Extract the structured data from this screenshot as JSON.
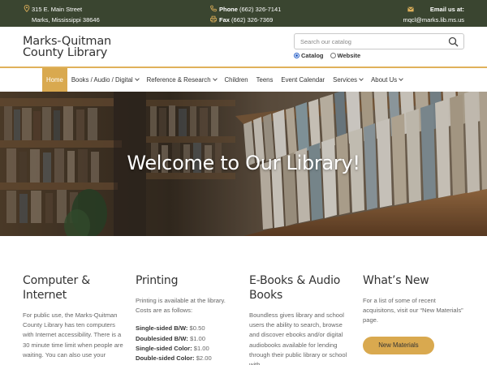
{
  "topbar": {
    "address_line1": "315 E. Main Street",
    "address_line2": "Marks, Mississippi 38646",
    "phone_label": "Phone",
    "phone_value": "(662) 326-7141",
    "fax_label": "Fax",
    "fax_value": "(662) 326-7369",
    "email_label": "Email us at:",
    "email_value": "mqcl@marks.lib.ms.us",
    "background_color": "#3a4530"
  },
  "header": {
    "title_line1": "Marks-Quitman",
    "title_line2": "County Library",
    "search_placeholder": "Search our catalog",
    "radio_catalog": "Catalog",
    "radio_website": "Website",
    "radio_selected": "Catalog"
  },
  "nav": {
    "accent_color": "#d9a94f",
    "items": [
      {
        "label": "Home",
        "active": true,
        "dropdown": false
      },
      {
        "label": "Books / Audio / Digital",
        "active": false,
        "dropdown": true
      },
      {
        "label": "Reference & Research",
        "active": false,
        "dropdown": true
      },
      {
        "label": "Children",
        "active": false,
        "dropdown": false
      },
      {
        "label": "Teens",
        "active": false,
        "dropdown": false
      },
      {
        "label": "Event Calendar",
        "active": false,
        "dropdown": false
      },
      {
        "label": "Services",
        "active": false,
        "dropdown": true
      },
      {
        "label": "About Us",
        "active": false,
        "dropdown": true
      }
    ]
  },
  "hero": {
    "title": "Welcome to Our Library!"
  },
  "columns": {
    "computer": {
      "title": "Computer & Internet",
      "text": "For public use, the Marks-Quitman County Library has ten computers with Internet accessibility. There is a 30 minute time limit when people are waiting. You can also use your"
    },
    "printing": {
      "title": "Printing",
      "text": "Printing is available at the library. Costs are as follows:",
      "prices": [
        {
          "label": "Single-sided B/W:",
          "price": "$0.50"
        },
        {
          "label": "Doublesided B/W:",
          "price": "$1.00"
        },
        {
          "label": "Single-sided Color:",
          "price": "$1.00"
        },
        {
          "label": "Double-sided Color:",
          "price": "$2.00"
        }
      ]
    },
    "ebooks": {
      "title": "E-Books & Audio Books",
      "text": "Boundless gives library and school users the ability to search, browse and discover ebooks and/or digital audiobooks available for lending through their public library or school with"
    },
    "whats_new": {
      "title": "What’s New",
      "text": "For a list of some of recent acquisitons, visit our “New Materials” page.",
      "button_label": "New Materials"
    }
  }
}
